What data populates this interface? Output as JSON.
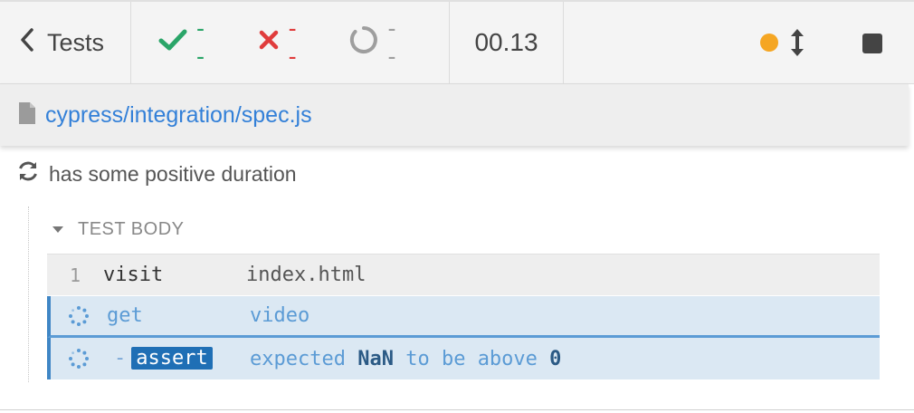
{
  "header": {
    "back_label": "Tests",
    "passed": "--",
    "failed": "--",
    "pending": "--",
    "duration": "00.13",
    "colors": {
      "pass": "#2aa568",
      "fail": "#e03c3c",
      "pending": "#9e9e9e",
      "running": "#f5a623"
    }
  },
  "spec": {
    "path": "cypress/integration/spec.js"
  },
  "test": {
    "title": "has some positive duration"
  },
  "hook": {
    "label": "TEST BODY"
  },
  "commands": [
    {
      "number": "1",
      "name": "visit",
      "message": "index.html"
    },
    {
      "number": "",
      "name": "get",
      "message": "video"
    },
    {
      "number": "",
      "prefix": "-",
      "name": "assert",
      "msg_parts": [
        "expected",
        "NaN",
        "to be above",
        "0"
      ]
    }
  ]
}
